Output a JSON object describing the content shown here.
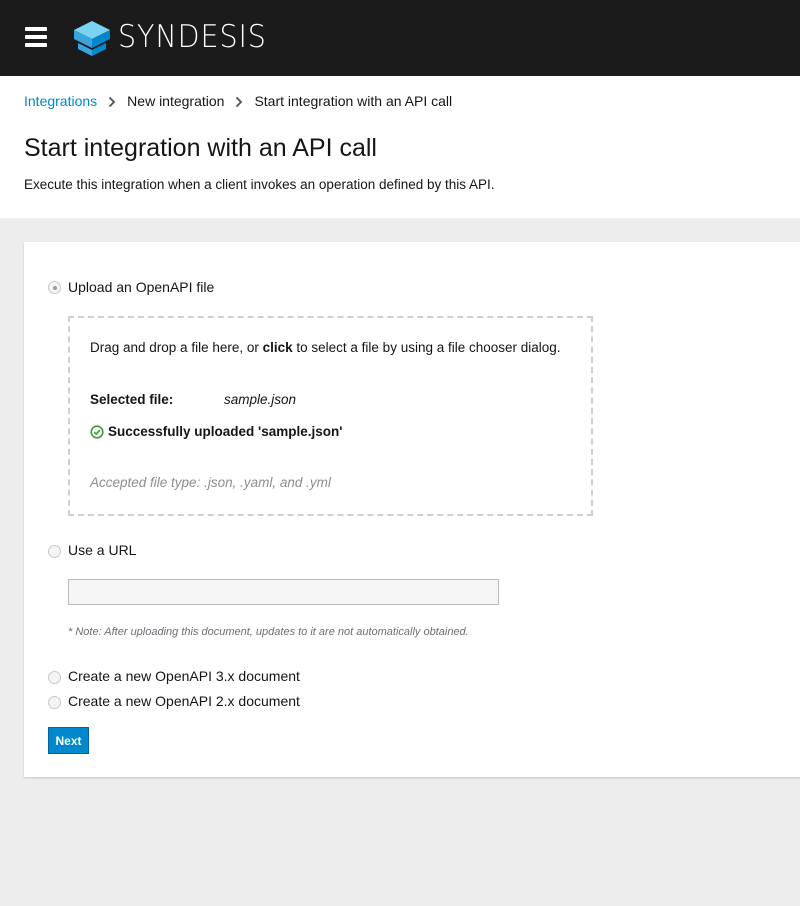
{
  "app": {
    "brand": "SYNDESIS",
    "menu_icon": "hamburger-menu-icon",
    "logo_icon": "syndesis-logo-icon"
  },
  "breadcrumb": {
    "items": [
      {
        "label": "Integrations",
        "link": true
      },
      {
        "label": "New integration",
        "link": false
      },
      {
        "label": "Start integration with an API call",
        "link": false
      }
    ],
    "separator_icon": "chevron-right-icon"
  },
  "page": {
    "title": "Start integration with an API call",
    "description": "Execute this integration when a client invokes an operation defined by this API."
  },
  "options": {
    "upload": {
      "label": "Upload an OpenAPI file",
      "selected": true,
      "dropzone": {
        "instruction_prefix": "Drag and drop a file here, or ",
        "instruction_bold": "click",
        "instruction_suffix": " to select a file by using a file chooser dialog.",
        "selected_file_label": "Selected file:",
        "selected_file_value": "sample.json",
        "success_message": "Successfully uploaded 'sample.json'",
        "success_icon": "check-circle-icon",
        "accepted_types": "Accepted file type: .json, .yaml, and .yml"
      }
    },
    "url": {
      "label": "Use a URL",
      "selected": false,
      "input_value": "",
      "note": "* Note: After uploading this document, updates to it are not automatically obtained."
    },
    "openapi3": {
      "label": "Create a new OpenAPI 3.x document",
      "selected": false
    },
    "openapi2": {
      "label": "Create a new OpenAPI 2.x document",
      "selected": false
    }
  },
  "actions": {
    "next_label": "Next"
  },
  "colors": {
    "topbar": "#1b1b1b",
    "link": "#0088ce",
    "primary_button": "#0088ce",
    "success": "#3f9c35",
    "logo_light": "#79d3f2",
    "logo_mid": "#39a5dc",
    "logo_dark": "#0088ce"
  }
}
